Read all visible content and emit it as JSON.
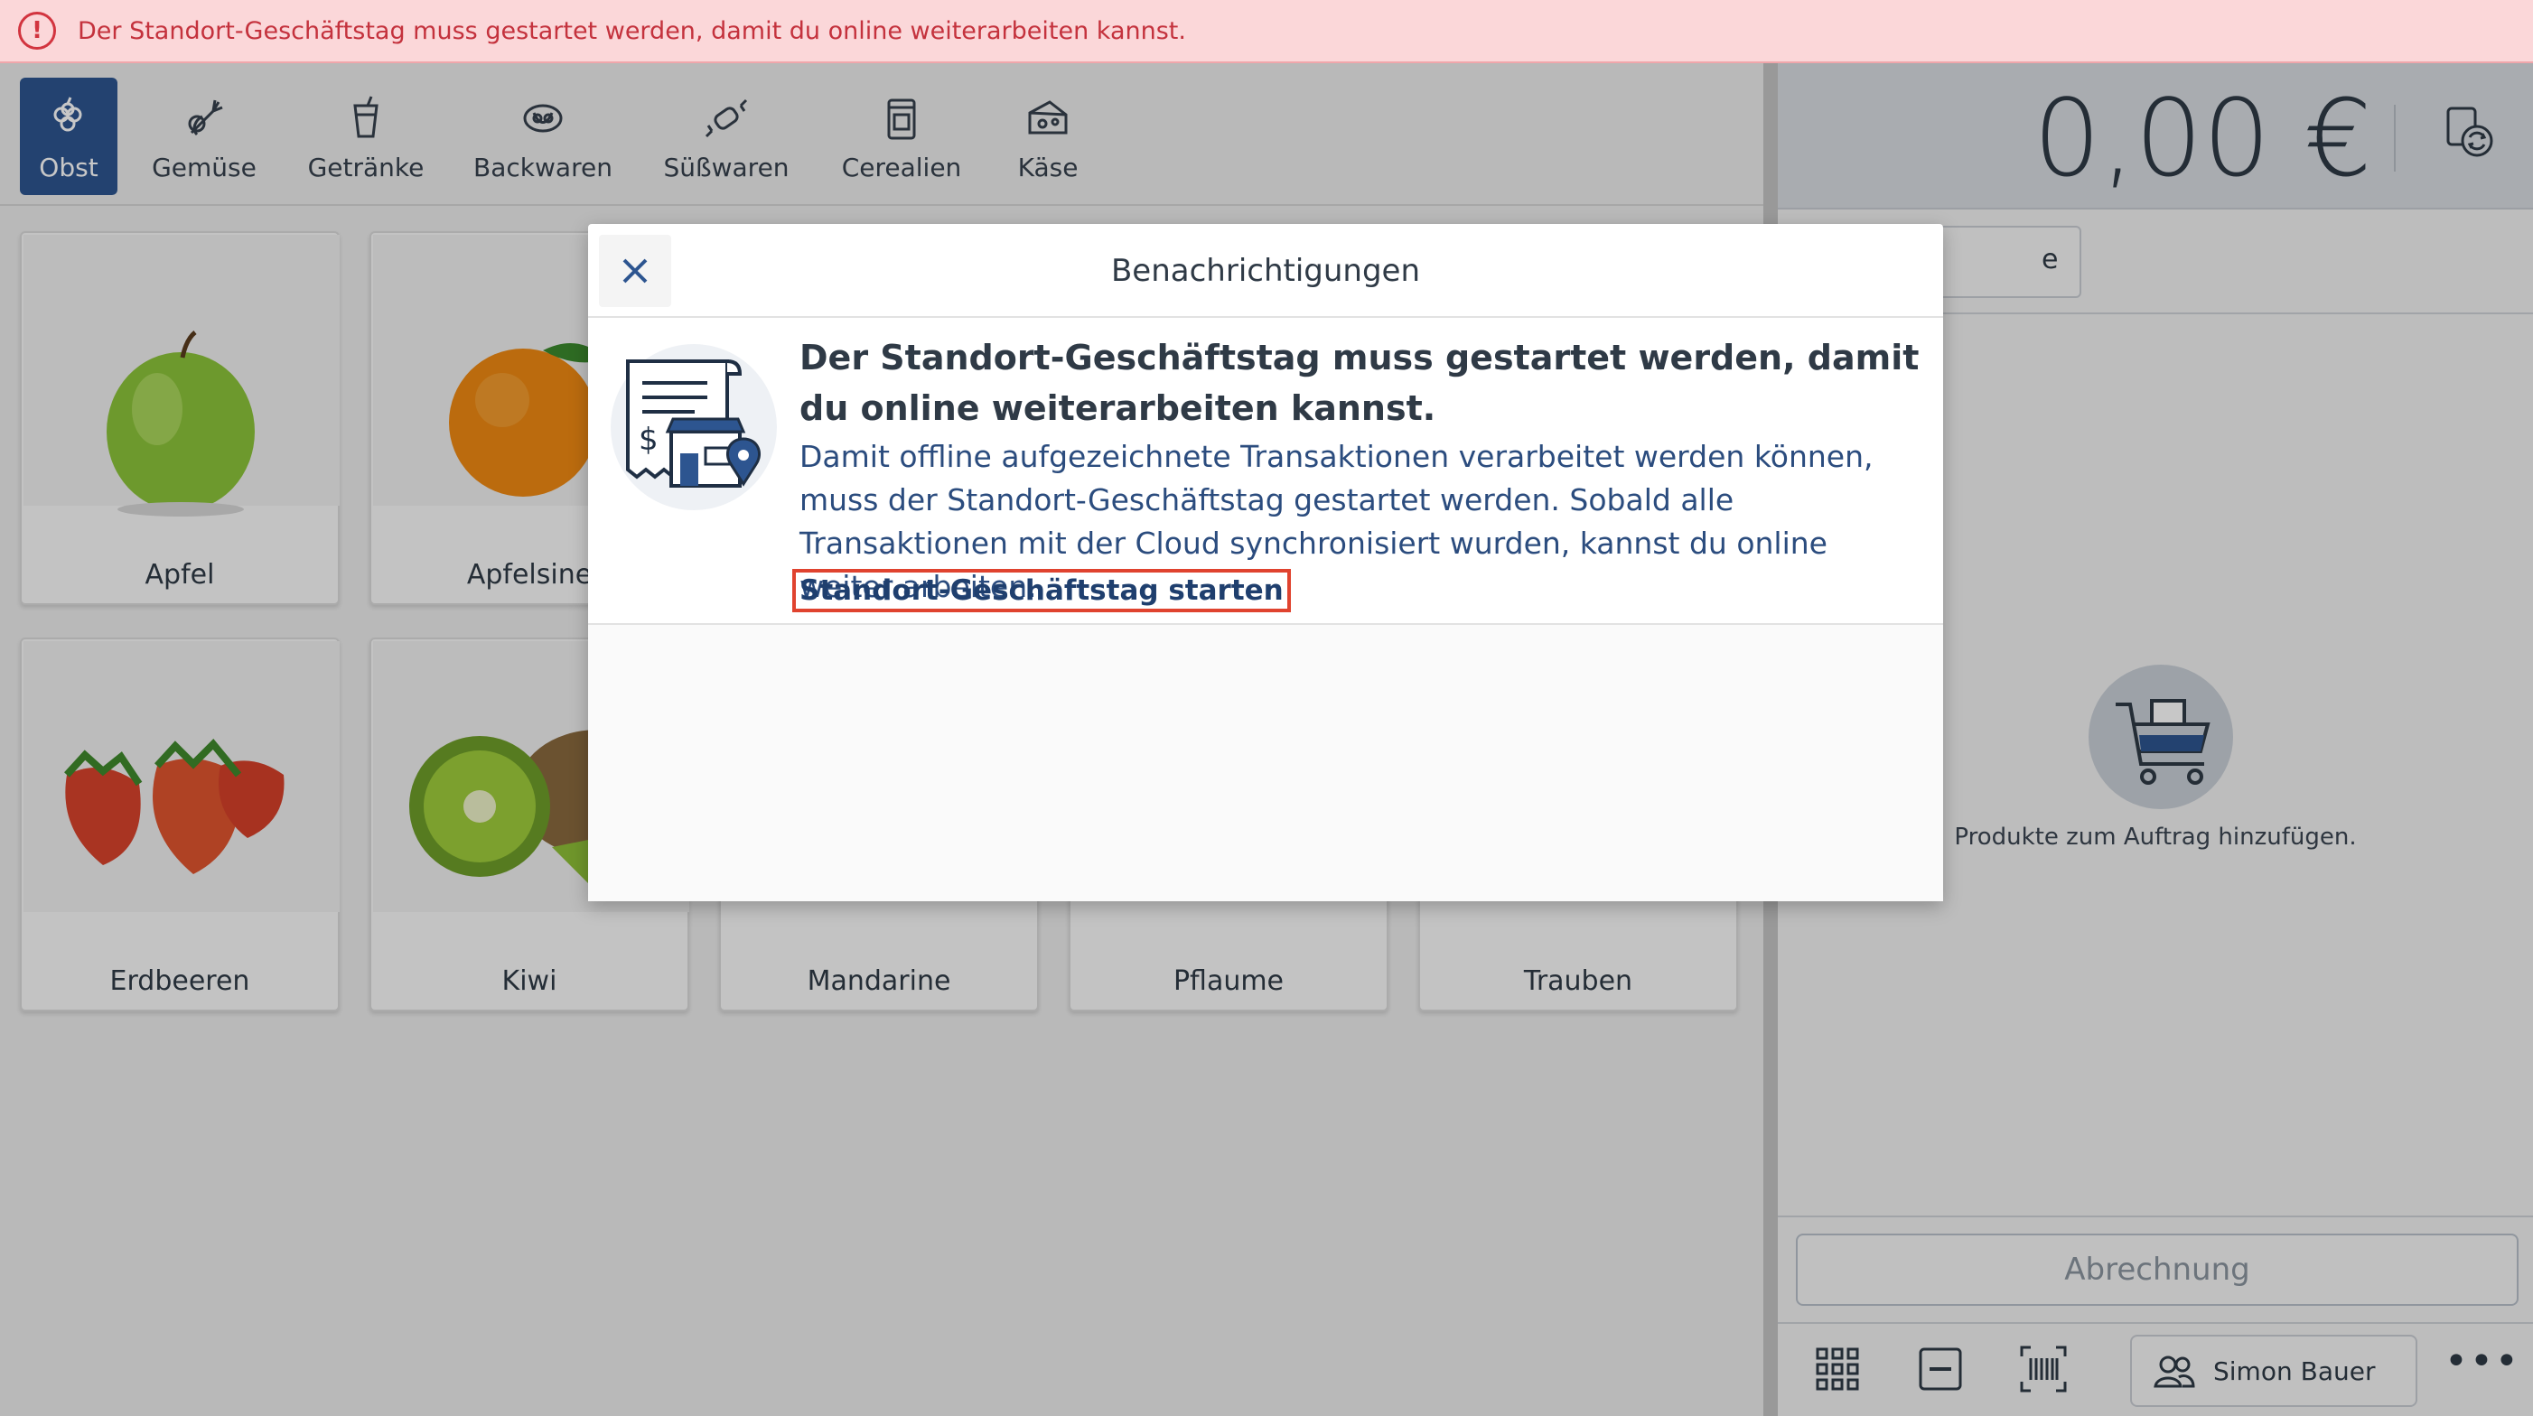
{
  "alert": {
    "icon": "exclamation-circle-icon",
    "text": "Der Standort-Geschäftstag muss gestartet werden, damit du online weiterarbeiten kannst.",
    "color": "#c4323d"
  },
  "categories": [
    {
      "label": "Obst",
      "icon": "fruit-icon",
      "active": true
    },
    {
      "label": "Gemüse",
      "icon": "vegetable-icon",
      "active": false
    },
    {
      "label": "Getränke",
      "icon": "drink-icon",
      "active": false
    },
    {
      "label": "Backwaren",
      "icon": "pretzel-icon",
      "active": false
    },
    {
      "label": "Süßwaren",
      "icon": "candy-icon",
      "active": false
    },
    {
      "label": "Cerealien",
      "icon": "cereal-jar-icon",
      "active": false
    },
    {
      "label": "Käse",
      "icon": "cheese-icon",
      "active": false
    }
  ],
  "products": [
    {
      "name": "Apfel"
    },
    {
      "name": "Apfelsine"
    },
    {
      "name": "Erdbeeren"
    },
    {
      "name": "Kiwi"
    },
    {
      "name": "Mandarine"
    },
    {
      "name": "Pflaume"
    },
    {
      "name": "Trauben"
    }
  ],
  "cart": {
    "total": "0,00 €",
    "tab_label": "e",
    "empty_text": "Produkte zum Auftrag hinzufügen.",
    "checkout_label": "Abrechnung",
    "user_name": "Simon Bauer",
    "more_label": "•••"
  },
  "modal": {
    "title": "Benachrichtigungen",
    "notification_title": "Der Standort-Geschäftstag muss gestartet werden, damit du online weiterarbeiten kannst.",
    "notification_body": "Damit offline aufgezeichnete Transaktionen verarbeitet werden können, muss der Standort-Geschäftstag gestartet werden. Sobald alle Transaktionen mit der Cloud synchronisiert wurden, kannst du online weiter arbeiten.",
    "link_label": "Standort-Geschäftstag starten"
  },
  "colors": {
    "accent": "#2d5590",
    "link_highlight": "#e0432f"
  }
}
